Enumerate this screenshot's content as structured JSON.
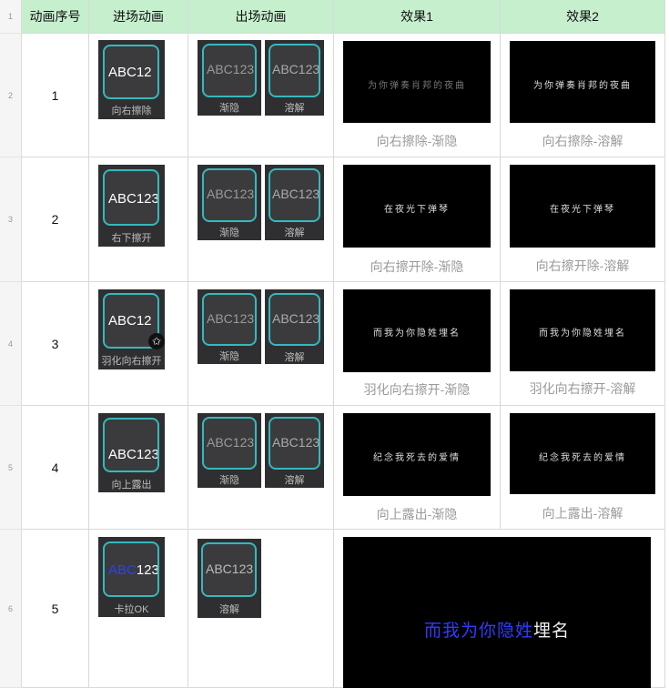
{
  "headers": [
    "动画序号",
    "进场动画",
    "出场动画",
    "效果1",
    "效果2"
  ],
  "row_numbers": [
    "1",
    "2",
    "3",
    "4",
    "5",
    "6"
  ],
  "rows": [
    {
      "index": "1",
      "entry": {
        "text": "ABC12",
        "caption": "向右擦除"
      },
      "exits": [
        {
          "text": "ABC123",
          "caption": "渐隐"
        },
        {
          "text": "ABC123",
          "caption": "溶解"
        }
      ],
      "effect1": {
        "subtitle": "为你弹奏肖邦的夜曲",
        "caption": "向右擦除-渐隐"
      },
      "effect2": {
        "subtitle": "为你弹奏肖邦的夜曲",
        "caption": "向右擦除-溶解"
      }
    },
    {
      "index": "2",
      "entry": {
        "text": "ABC123",
        "caption": "右下擦开"
      },
      "exits": [
        {
          "text": "ABC123",
          "caption": "渐隐"
        },
        {
          "text": "ABC123",
          "caption": "溶解"
        }
      ],
      "effect1": {
        "subtitle": "在夜光下弹琴",
        "caption": "向右擦开除-渐隐"
      },
      "effect2": {
        "subtitle": "在夜光下弹琴",
        "caption": "向右擦开除-溶解"
      }
    },
    {
      "index": "3",
      "entry": {
        "text": "ABC12",
        "caption": "羽化向右擦开"
      },
      "exits": [
        {
          "text": "ABC123",
          "caption": "渐隐"
        },
        {
          "text": "ABC123",
          "caption": "溶解"
        }
      ],
      "effect1": {
        "subtitle": "而我为你隐姓埋名",
        "caption": "羽化向右擦开-渐隐"
      },
      "effect2": {
        "subtitle": "而我为你隐姓埋名",
        "caption": "羽化向右擦开-溶解"
      }
    },
    {
      "index": "4",
      "entry": {
        "text": "ABC123",
        "caption": "向上露出"
      },
      "exits": [
        {
          "text": "ABC123",
          "caption": "渐隐"
        },
        {
          "text": "ABC123",
          "caption": "溶解"
        }
      ],
      "effect1": {
        "subtitle": "纪念我死去的爱情",
        "caption": "向上露出-渐隐"
      },
      "effect2": {
        "subtitle": "纪念我死去的爱情",
        "caption": "向上露出-溶解"
      }
    },
    {
      "index": "5",
      "entry": {
        "text_highlight": "ABC",
        "text_rest": "123",
        "caption": "卡拉OK"
      },
      "exits": [
        {
          "text": "ABC123",
          "caption": "溶解"
        }
      ],
      "effect": {
        "subtitle_highlight": "而我为你隐姓",
        "subtitle_rest": "埋名"
      }
    }
  ],
  "colors": {
    "header_bg": "#c6efce",
    "frame_accent": "#34b9be",
    "karaoke_blue": "#2f3cff"
  },
  "icons": {
    "row3_badge": "star-icon"
  }
}
